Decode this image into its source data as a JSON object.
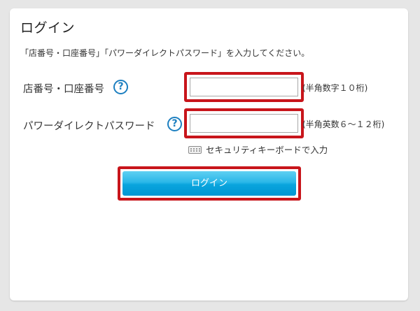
{
  "page": {
    "title": "ログイン",
    "instruction": "「店番号・口座番号」「パワーダイレクトパスワード」を入力してください。"
  },
  "fields": {
    "account": {
      "label": "店番号・口座番号",
      "help": "?",
      "value": "",
      "placeholder": "",
      "hint": "(半角数字１０桁)"
    },
    "password": {
      "label": "パワーダイレクトパスワード",
      "help": "?",
      "value": "",
      "placeholder": "",
      "hint": "(半角英数６～１２桁)"
    }
  },
  "security_keyboard": {
    "icon": "keyboard-icon",
    "label": "セキュリティキーボードで入力"
  },
  "login_button": {
    "label": "ログイン"
  },
  "colors": {
    "highlight": "#c8151b",
    "help_icon": "#1c7fc0",
    "button": "#0096d3"
  }
}
